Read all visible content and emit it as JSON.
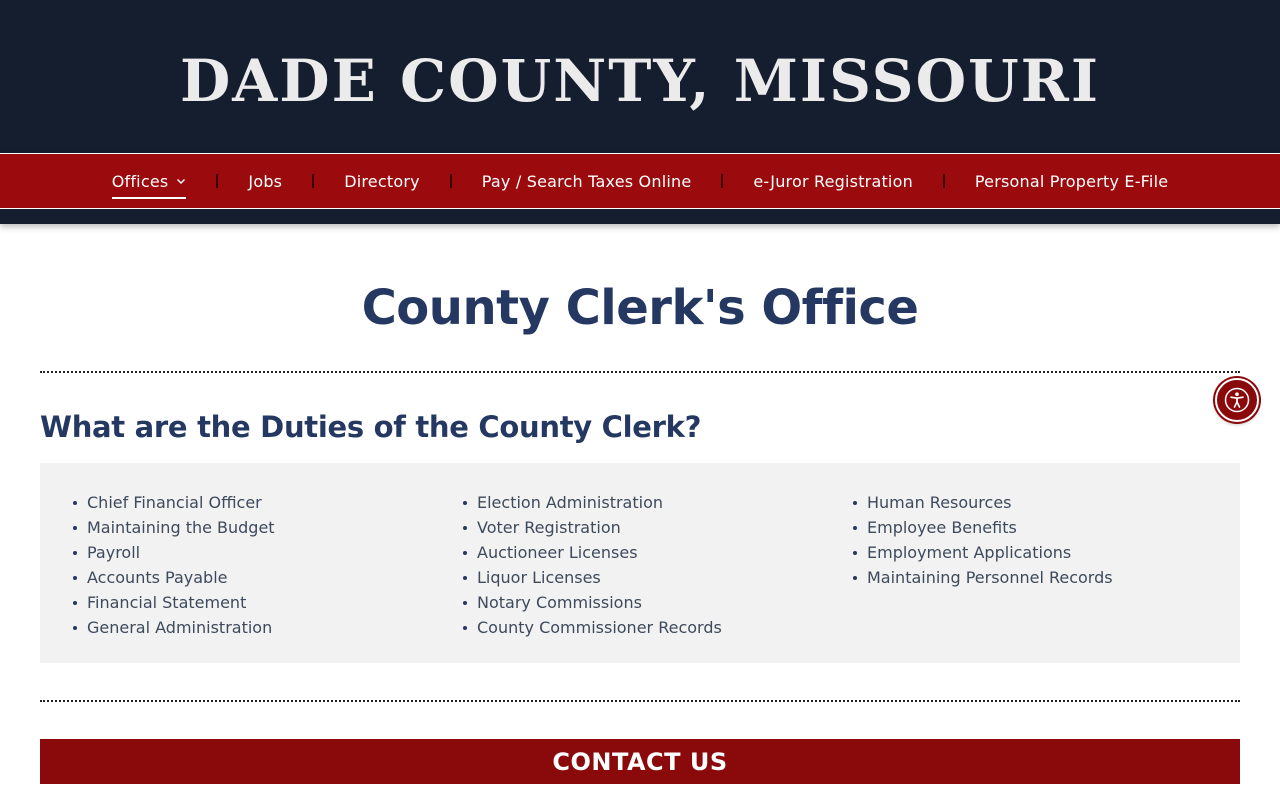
{
  "header": {
    "site_title": "DADE COUNTY, MISSOURI"
  },
  "nav": {
    "items": [
      {
        "label": "Offices",
        "active": true,
        "has_dropdown": true
      },
      {
        "label": "Jobs"
      },
      {
        "label": "Directory"
      },
      {
        "label": "Pay / Search Taxes Online"
      },
      {
        "label": "e-Juror Registration"
      },
      {
        "label": "Personal Property E-File"
      }
    ]
  },
  "main": {
    "page_title": "County Clerk's Office",
    "section_heading": "What are the Duties of the County Clerk?",
    "duties": {
      "column1": [
        "Chief Financial Officer",
        "Maintaining the Budget",
        "Payroll",
        "Accounts Payable",
        "Financial Statement",
        "General Administration"
      ],
      "column2": [
        "Election Administration",
        "Voter Registration",
        "Auctioneer Licenses",
        "Liquor Licenses",
        "Notary Commissions",
        "County Commissioner Records"
      ],
      "column3": [
        "Human Resources",
        "Employee Benefits",
        "Employment Applications",
        "Maintaining Personnel Records"
      ]
    },
    "contact_label": "CONTACT US"
  },
  "colors": {
    "navy": "#151e2f",
    "nav_red": "#9b0a0d",
    "heading_blue": "#253862",
    "contact_red": "#8a0a0c"
  },
  "icons": {
    "accessibility": "accessibility-icon",
    "dropdown": "chevron-down-icon"
  }
}
